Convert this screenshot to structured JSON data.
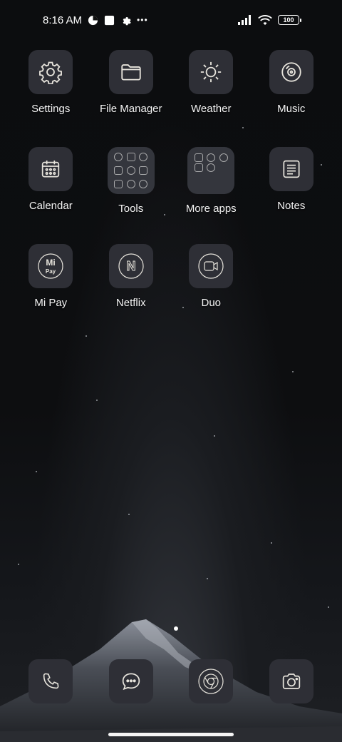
{
  "status_bar": {
    "time": "8:16 AM",
    "icons_left": [
      "data-saver-icon",
      "square-notification-icon",
      "gear-icon",
      "more-dots-icon"
    ],
    "more_glyph": "•••",
    "battery": "100",
    "icons_right": [
      "signal-icon",
      "wifi-icon",
      "battery-icon"
    ]
  },
  "apps": [
    {
      "label": "Settings",
      "icon": "gear-icon"
    },
    {
      "label": "File Manager",
      "icon": "folder-icon"
    },
    {
      "label": "Weather",
      "icon": "sun-icon"
    },
    {
      "label": "Music",
      "icon": "disc-icon"
    },
    {
      "label": "Calendar",
      "icon": "calendar-icon"
    },
    {
      "label": "Tools",
      "icon": "folder-tools"
    },
    {
      "label": "More apps",
      "icon": "folder-more-apps"
    },
    {
      "label": "Notes",
      "icon": "notes-icon"
    },
    {
      "label": "Mi Pay",
      "icon": "mi-pay-icon",
      "logo_text": "Mi",
      "logo_sub": "Pay"
    },
    {
      "label": "Netflix",
      "icon": "netflix-icon",
      "logo_text": "N"
    },
    {
      "label": "Duo",
      "icon": "video-camera-icon"
    }
  ],
  "page_indicator": {
    "pages": 2,
    "active": 2
  },
  "dock": [
    {
      "icon": "phone-icon"
    },
    {
      "icon": "messages-icon"
    },
    {
      "icon": "chrome-icon"
    },
    {
      "icon": "camera-icon"
    }
  ]
}
